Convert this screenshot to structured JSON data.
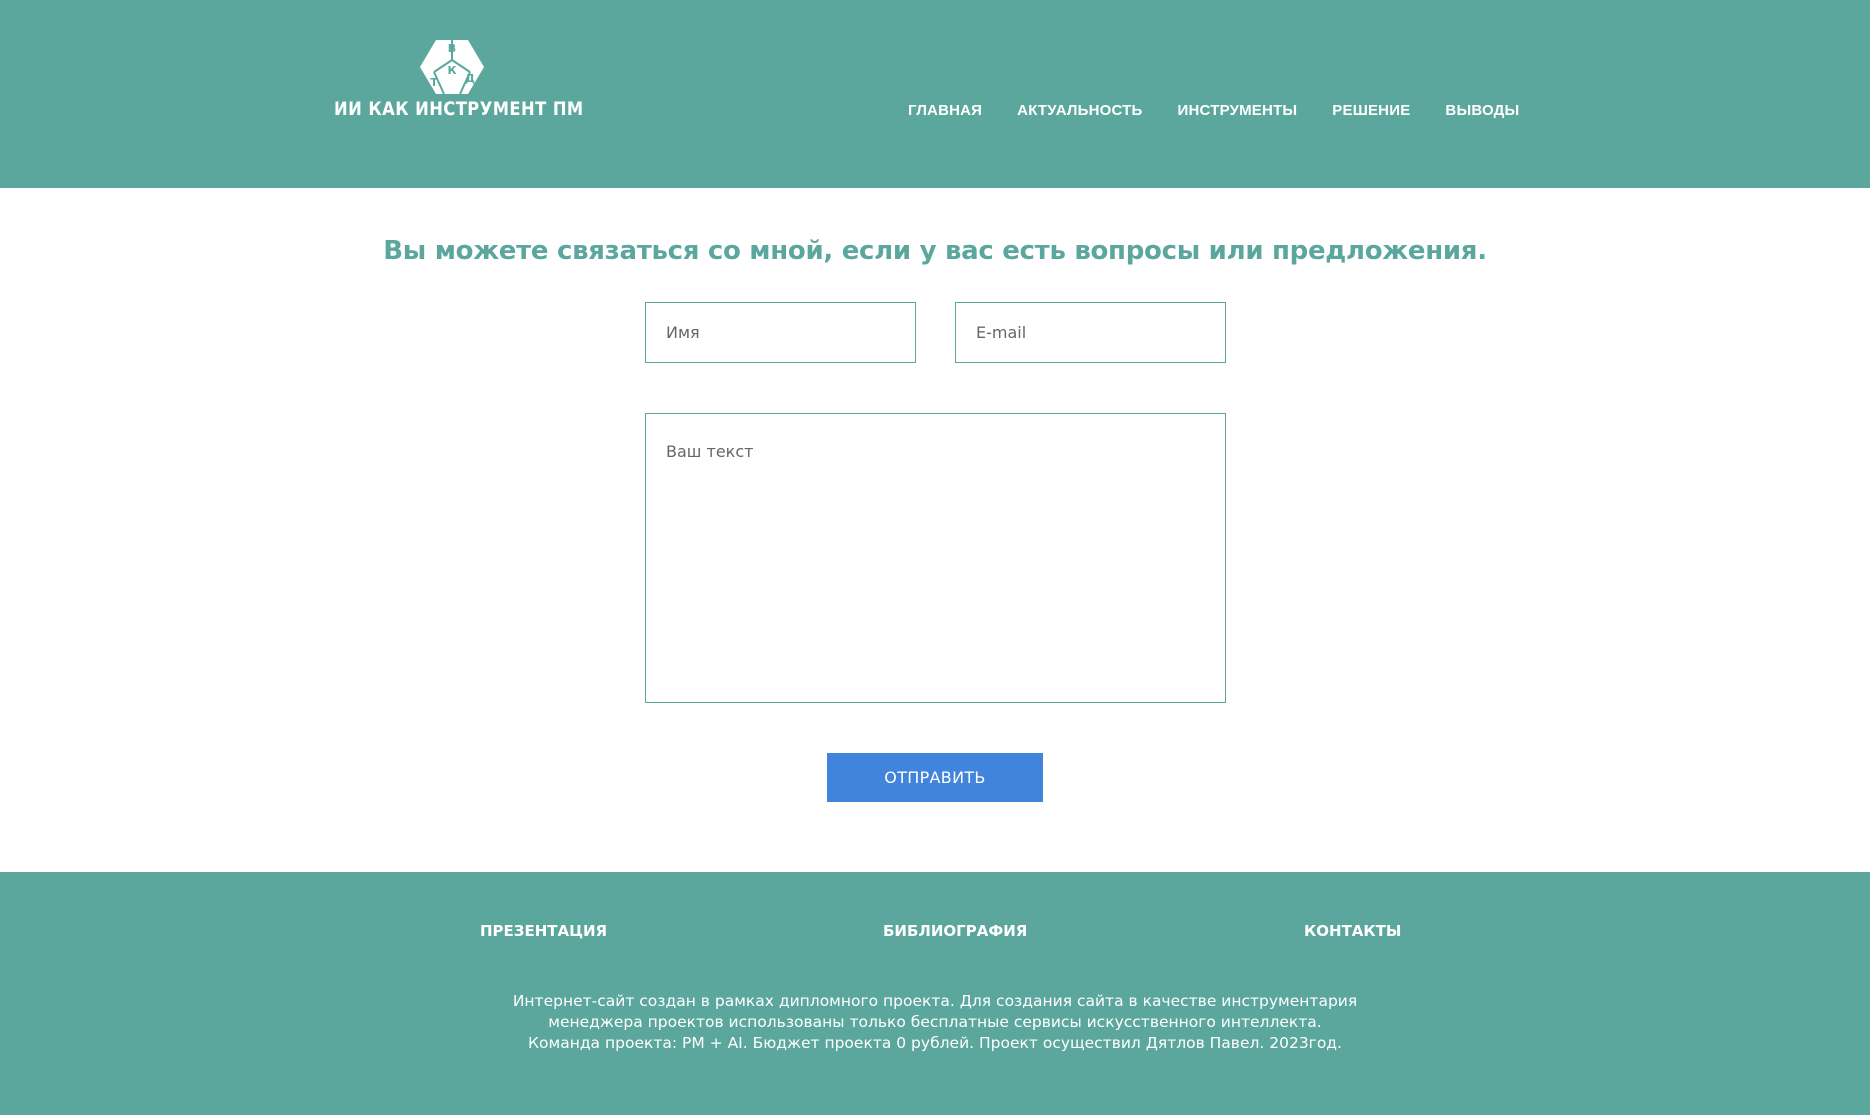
{
  "header": {
    "logo_text": "ИИ КАК ИНСТРУМЕНТ ПМ",
    "logo_letters": [
      "В",
      "К",
      "Т",
      "Д"
    ],
    "nav": [
      "ГЛАВНАЯ",
      "АКТУАЛЬНОСТЬ",
      "ИНСТРУМЕНТЫ",
      "РЕШЕНИЕ",
      "ВЫВОДЫ"
    ]
  },
  "main": {
    "heading": "Вы можете связаться со мной, если у вас есть вопросы или предложения.",
    "name_placeholder": "Имя",
    "email_placeholder": "E-mail",
    "text_placeholder": "Ваш текст",
    "submit_label": "ОТПРАВИТЬ"
  },
  "footer": {
    "links": [
      "ПРЕЗЕНТАЦИЯ",
      "БИБЛИОГРАФИЯ",
      "КОНТАКТЫ"
    ],
    "text_lines": [
      "Интернет-сайт создан в рамках дипломного проекта. Для создания сайта в качестве инструментария",
      "менеджера проектов использованы только бесплатные сервисы искусственного интеллекта.",
      "Команда проекта: PM + AI. Бюджет проекта 0 рублей. Проект осуществил Дятлов Павел. 2023год."
    ]
  },
  "colors": {
    "brand": "#5ba79d",
    "button": "#4184db"
  }
}
